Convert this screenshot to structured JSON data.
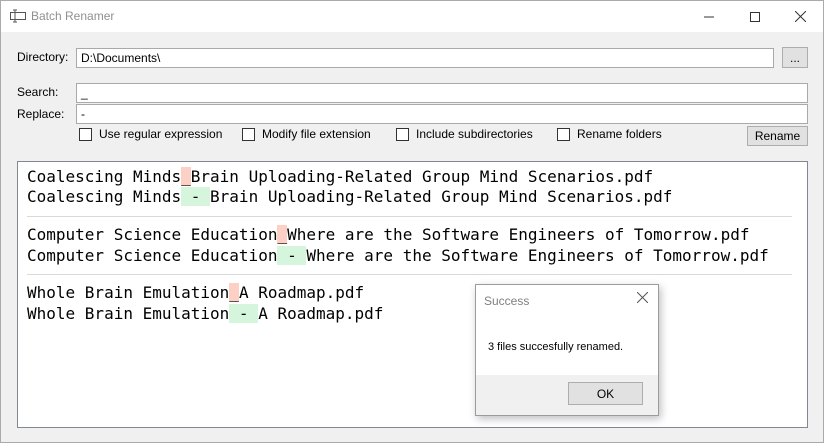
{
  "window": {
    "title": "Batch Renamer",
    "icon": "rename-app-icon",
    "controls": {
      "minimize": "minimize-icon",
      "maximize": "maximize-icon",
      "close": "close-icon"
    }
  },
  "form": {
    "directory_label": "Directory:",
    "directory_value": "D:\\Documents\\",
    "browse_label": "...",
    "search_label": "Search:",
    "search_value": "_",
    "replace_label": "Replace:",
    "replace_value": "-",
    "options": [
      {
        "label": "Use regular expression",
        "checked": false
      },
      {
        "label": "Modify file extension",
        "checked": false
      },
      {
        "label": "Include subdirectories",
        "checked": false
      },
      {
        "label": "Rename folders",
        "checked": false
      }
    ],
    "rename_label": "Rename"
  },
  "results": [
    {
      "old": {
        "pre": "Coalescing Minds",
        "match": "_",
        "post": "Brain Uploading-Related Group Mind Scenarios.pdf"
      },
      "new": {
        "pre": "Coalescing Minds",
        "match": " - ",
        "post": "Brain Uploading-Related Group Mind Scenarios.pdf"
      }
    },
    {
      "old": {
        "pre": "Computer Science Education",
        "match": "_",
        "post": "Where are the Software Engineers of Tomorrow.pdf"
      },
      "new": {
        "pre": "Computer Science Education",
        "match": " - ",
        "post": "Where are the Software Engineers of Tomorrow.pdf"
      }
    },
    {
      "old": {
        "pre": "Whole Brain Emulation",
        "match": "_",
        "post": "A Roadmap.pdf"
      },
      "new": {
        "pre": "Whole Brain Emulation",
        "match": " - ",
        "post": "A Roadmap.pdf"
      }
    }
  ],
  "colors": {
    "removed_highlight": "#fcd0c4",
    "added_highlight": "#d5f5dd"
  },
  "dialog": {
    "title": "Success",
    "message": "3 files succesfully renamed.",
    "ok_label": "OK",
    "close_icon": "close-icon"
  }
}
